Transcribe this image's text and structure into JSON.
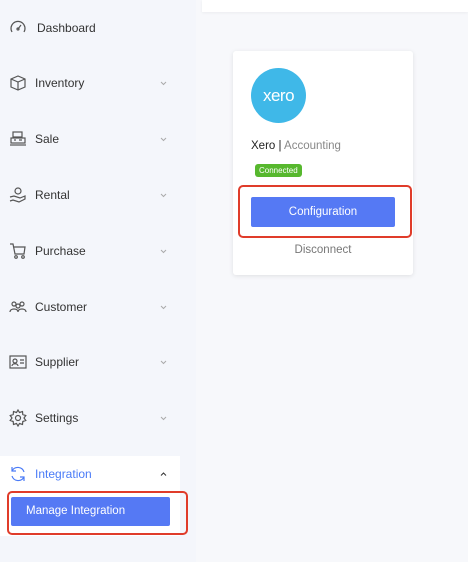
{
  "sidebar": {
    "items": [
      {
        "label": "Dashboard",
        "icon": "dashboard-gauge-icon"
      },
      {
        "label": "Inventory",
        "icon": "inventory-box-icon"
      },
      {
        "label": "Sale",
        "icon": "sale-register-icon"
      },
      {
        "label": "Rental",
        "icon": "rental-hand-icon"
      },
      {
        "label": "Purchase",
        "icon": "cart-icon"
      },
      {
        "label": "Customer",
        "icon": "customers-icon"
      },
      {
        "label": "Supplier",
        "icon": "supplier-card-icon"
      },
      {
        "label": "Settings",
        "icon": "gear-icon"
      },
      {
        "label": "Integration",
        "icon": "integration-sync-icon"
      }
    ],
    "integration_sub": {
      "label": "Manage Integration"
    }
  },
  "integration_card": {
    "logo_text": "xero",
    "name": "Xero",
    "separator": " | ",
    "category": "Accounting",
    "status": "Connected",
    "configure_label": "Configuration",
    "disconnect_label": "Disconnect"
  },
  "colors": {
    "accent": "#5579f4",
    "active_text": "#4a7bf7",
    "xero_blue": "#3fb8e8",
    "connected_green": "#57b82e",
    "highlight_red": "#e03c2a"
  }
}
